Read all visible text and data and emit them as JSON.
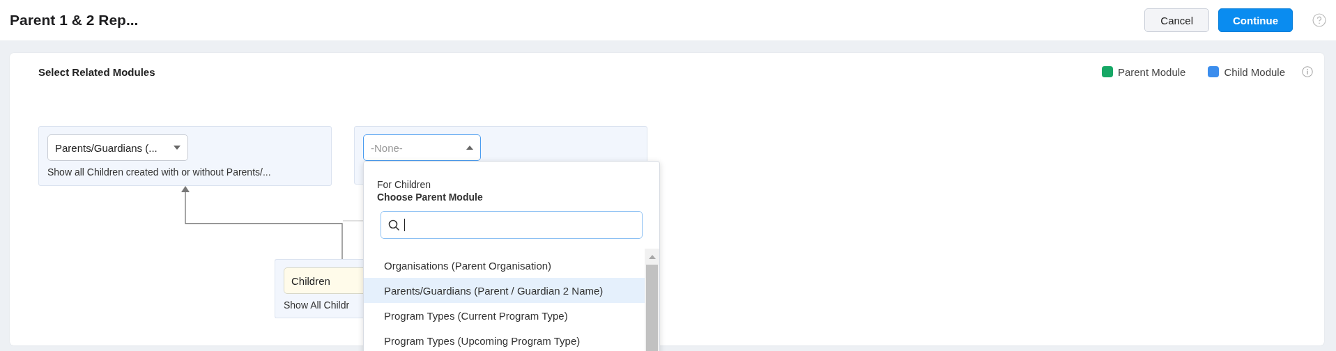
{
  "header": {
    "title": "Parent 1 & 2 Rep...",
    "buttons": [
      {
        "label": "Cancel",
        "kind": "secondary"
      },
      {
        "label": "Continue",
        "kind": "primary"
      }
    ]
  },
  "section": {
    "title": "Select Related Modules",
    "legend": [
      {
        "label": "Parent Module",
        "color": "#16a765"
      },
      {
        "label": "Child Module",
        "color": "#3b8ded"
      }
    ]
  },
  "nodes": [
    {
      "kind": "parent",
      "select_value": "Parents/Guardians (...",
      "description": "Show all Children created with or without Parents/...",
      "expanded": false
    },
    {
      "kind": "parent",
      "select_placeholder": "-None-",
      "expanded": true
    },
    {
      "kind": "child",
      "select_value": "Children",
      "description": "Show All Childr",
      "expanded": false
    }
  ],
  "dropdown": {
    "context": "For Children",
    "heading": "Choose Parent Module",
    "options": [
      {
        "label": "Organisations (Parent Organisation)",
        "selected": false
      },
      {
        "label": "Parents/Guardians (Parent / Guardian 2 Name)",
        "selected": true
      },
      {
        "label": "Program Types (Current Program Type)",
        "selected": false
      },
      {
        "label": "Program Types (Upcoming Program Type)",
        "selected": false
      }
    ]
  }
}
